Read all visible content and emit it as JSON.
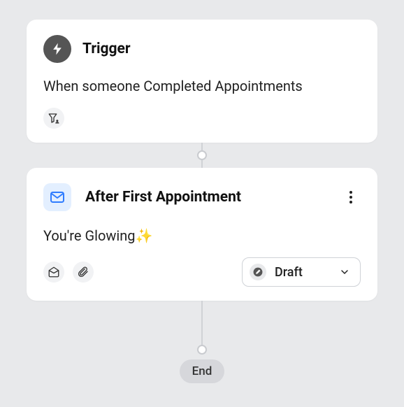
{
  "trigger": {
    "title": "Trigger",
    "description": "When someone Completed Appointments",
    "filter_icon": "filter-person-icon"
  },
  "action": {
    "title": "After First Appointment",
    "body": "You're Glowing✨",
    "status": {
      "label": "Draft"
    }
  },
  "end": {
    "label": "End"
  }
}
